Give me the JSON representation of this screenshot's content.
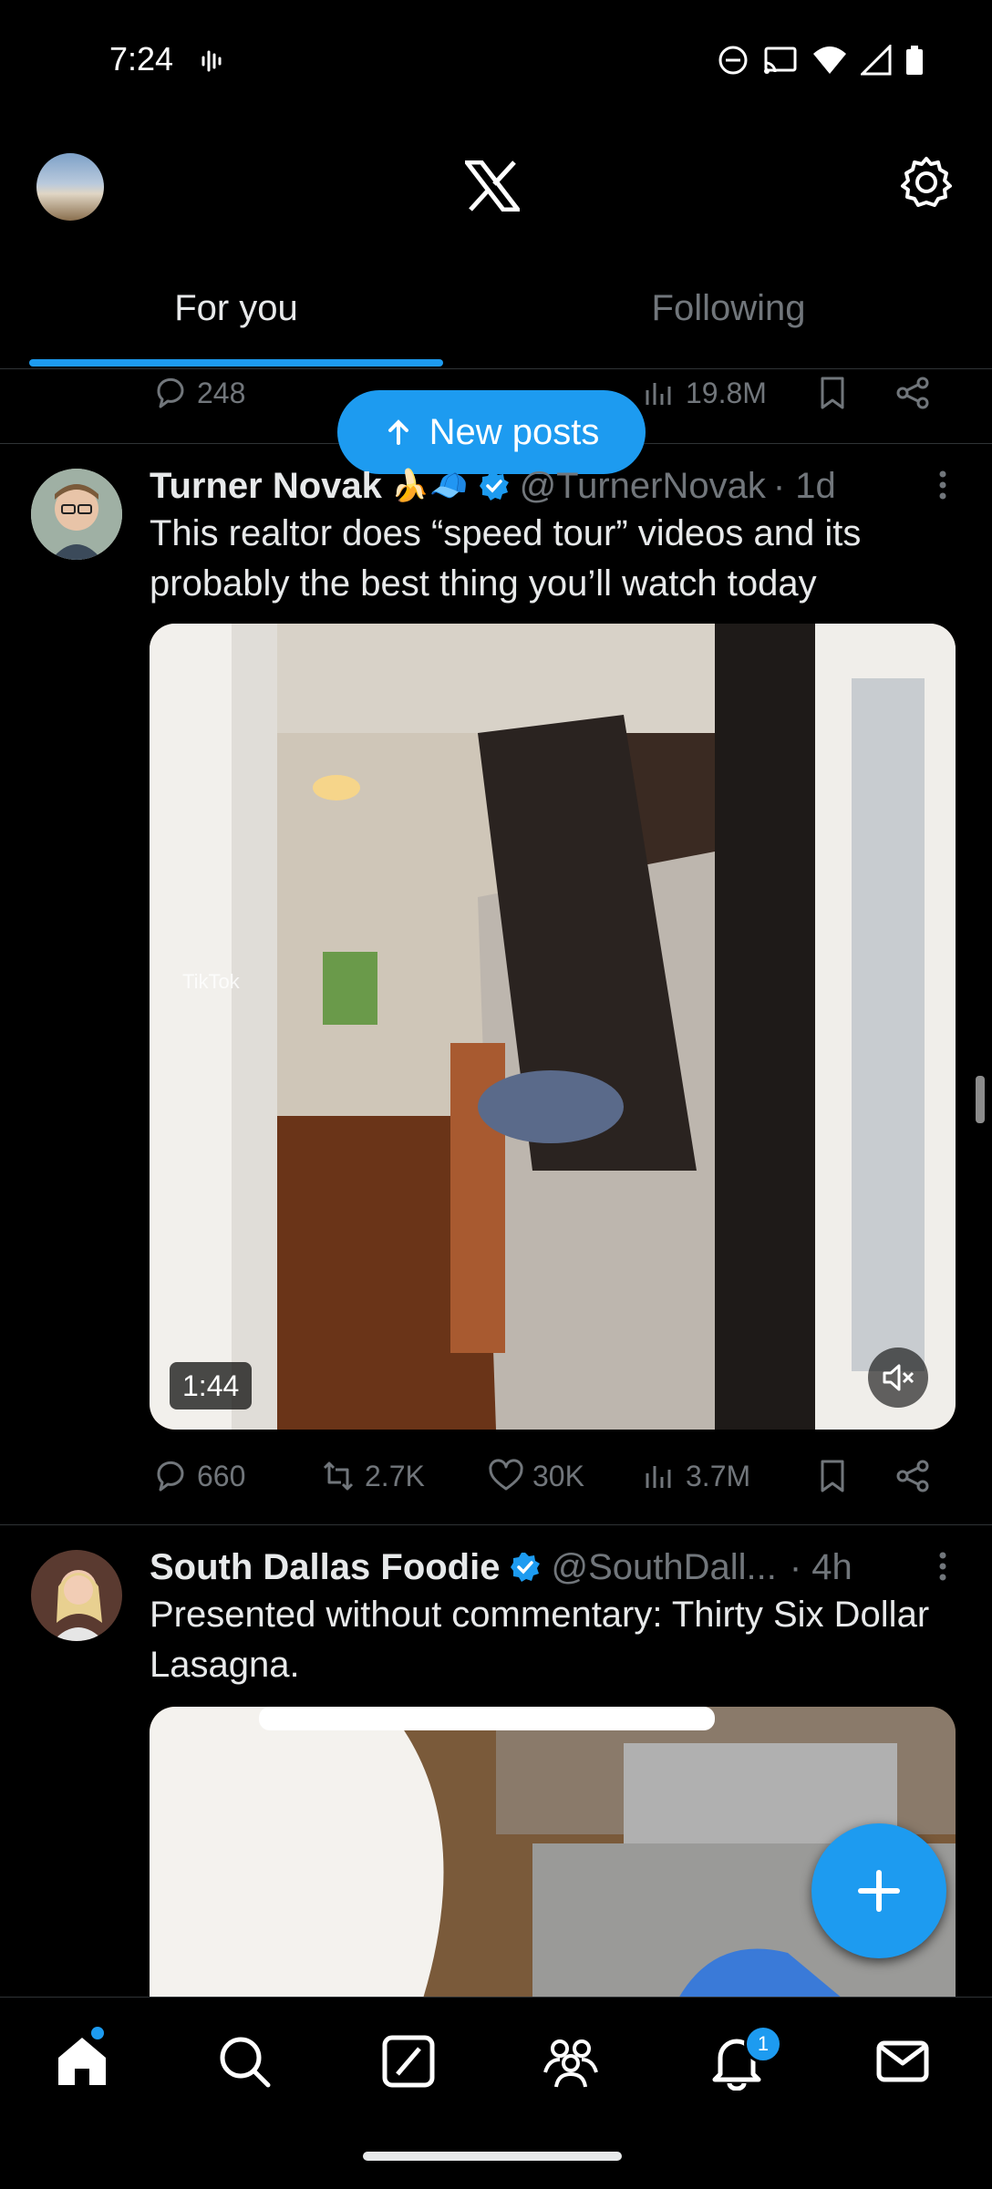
{
  "status_bar": {
    "time": "7:24"
  },
  "header": {
    "title_icon": "x-logo-icon",
    "settings_icon": "gear-icon"
  },
  "tabs": [
    {
      "label": "For you",
      "selected": true
    },
    {
      "label": "Following",
      "selected": false
    }
  ],
  "new_posts_label": "New posts",
  "prev_post_actions": {
    "replies": "248",
    "views": "19.8M"
  },
  "posts": [
    {
      "name": "Turner Novak",
      "emoji": "🍌🧢",
      "handle": "@TurnerNovak",
      "time": "· 1d",
      "text": "This realtor does “speed tour” videos and its probably the best thing you’ll watch today",
      "media": {
        "type": "video",
        "duration": "1:44",
        "watermark": "TikTok"
      },
      "actions": {
        "replies": "660",
        "reposts": "2.7K",
        "likes": "30K",
        "views": "3.7M"
      }
    },
    {
      "name": "South Dallas Foodie",
      "handle": "@SouthDall...",
      "time": "· 4h",
      "text": "Presented without commentary: Thirty Six Dollar Lasagna."
    }
  ],
  "bottom_nav": {
    "items": [
      "home-icon",
      "search-icon",
      "grok-icon",
      "communities-icon",
      "notifications-icon",
      "messages-icon"
    ],
    "notification_count": "1"
  },
  "colors": {
    "accent": "#1d9bf0",
    "background": "#000000",
    "muted": "#71767b",
    "text": "#e7e9ea"
  }
}
